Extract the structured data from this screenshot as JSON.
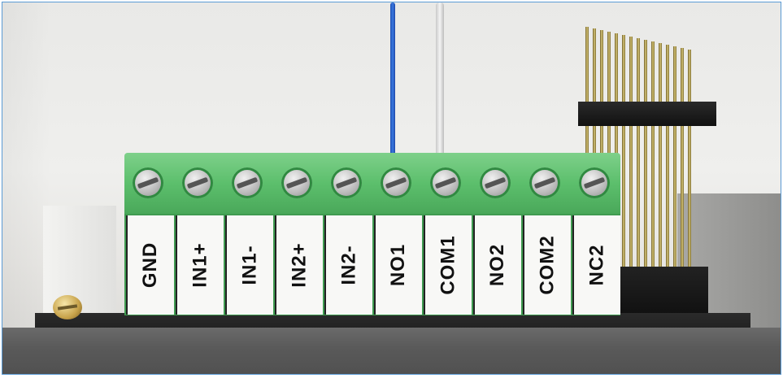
{
  "terminal_block": {
    "labels": [
      "GND",
      "IN1+",
      "IN1-",
      "IN2+",
      "IN2-",
      "NO1",
      "COM1",
      "NO2",
      "COM2",
      "NC2"
    ],
    "body_color": "#5cbf6c",
    "label_color": "#f8f8f6"
  },
  "colors": {
    "border": "#5b9bd5",
    "wire_blue": "#2f6ad0",
    "wire_white": "#e8e8e8",
    "housing": "#5a5a5a"
  }
}
